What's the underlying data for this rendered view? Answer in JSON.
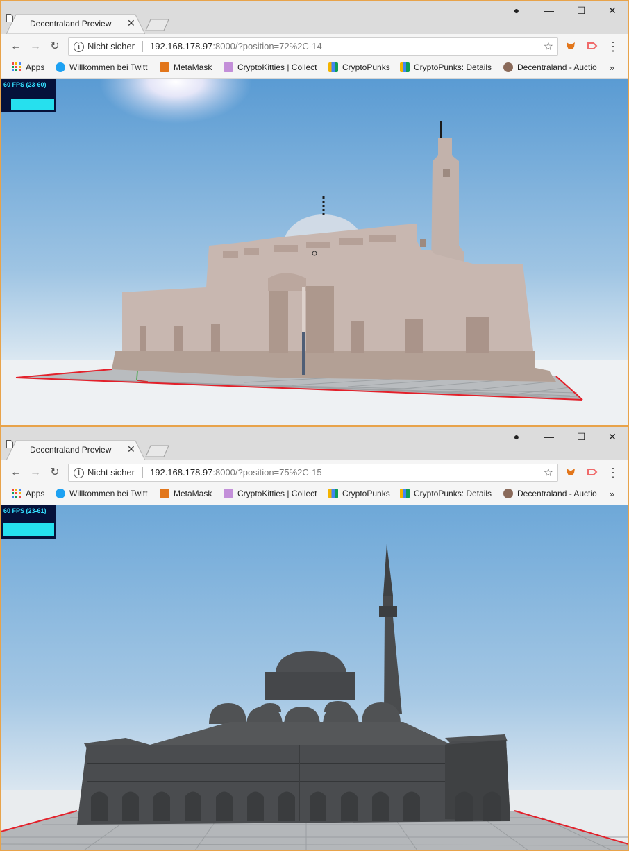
{
  "windows": [
    {
      "tab_title": "Decentraland Preview",
      "security": "Nicht sicher",
      "url_host": "192.168.178.97",
      "url_rest": ":8000/?position=72%2C-14",
      "fps": "60 FPS (23-60)",
      "bookmarks": [
        "Apps",
        "Willkommen bei Twitt",
        "MetaMask",
        "CryptoKitties | Collect",
        "CryptoPunks",
        "CryptoPunks: Details",
        "Decentraland - Auctio"
      ]
    },
    {
      "tab_title": "Decentraland Preview",
      "security": "Nicht sicher",
      "url_host": "192.168.178.97",
      "url_rest": ":8000/?position=75%2C-15",
      "fps": "60 FPS (23-61)",
      "bookmarks": [
        "Apps",
        "Willkommen bei Twitt",
        "MetaMask",
        "CryptoKitties | Collect",
        "CryptoPunks",
        "CryptoPunks: Details",
        "Decentraland - Auctio"
      ]
    }
  ],
  "colors": {
    "sky_top": "#6aa6d8",
    "sky_horizon": "#dde9f2",
    "mosque1_wall": "#c8b7b0",
    "mosque2_body": "#555759",
    "parcel_border": "#e3202a",
    "fps_bg": "#05113a",
    "fps_text": "#35e0ff"
  },
  "icons": {
    "back": "arrow-left-icon",
    "forward": "arrow-right-icon",
    "reload": "reload-icon",
    "info": "info-icon",
    "star": "star-icon",
    "more": "more-vert-icon"
  }
}
